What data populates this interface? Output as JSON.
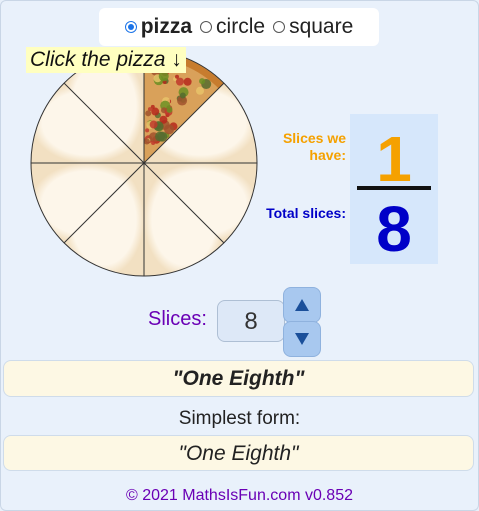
{
  "modes": [
    {
      "label": "pizza",
      "selected": true
    },
    {
      "label": "circle",
      "selected": false
    },
    {
      "label": "square",
      "selected": false
    }
  ],
  "hint": "Click the pizza ↓",
  "pizza": {
    "total_slices": 8,
    "filled_slices": 1
  },
  "fraction": {
    "have_label": "Slices we have:",
    "total_label": "Total slices:",
    "numerator": "1",
    "denominator": "8",
    "numerator_color": "#f5a100",
    "denominator_color": "#0000c8"
  },
  "slices": {
    "label": "Slices:",
    "value": "8"
  },
  "fraction_words": "\"One Eighth\"",
  "simplest": {
    "label": "Simplest form:",
    "value": "\"One Eighth\""
  },
  "footer": "© 2021 MathsIsFun.com v0.852"
}
